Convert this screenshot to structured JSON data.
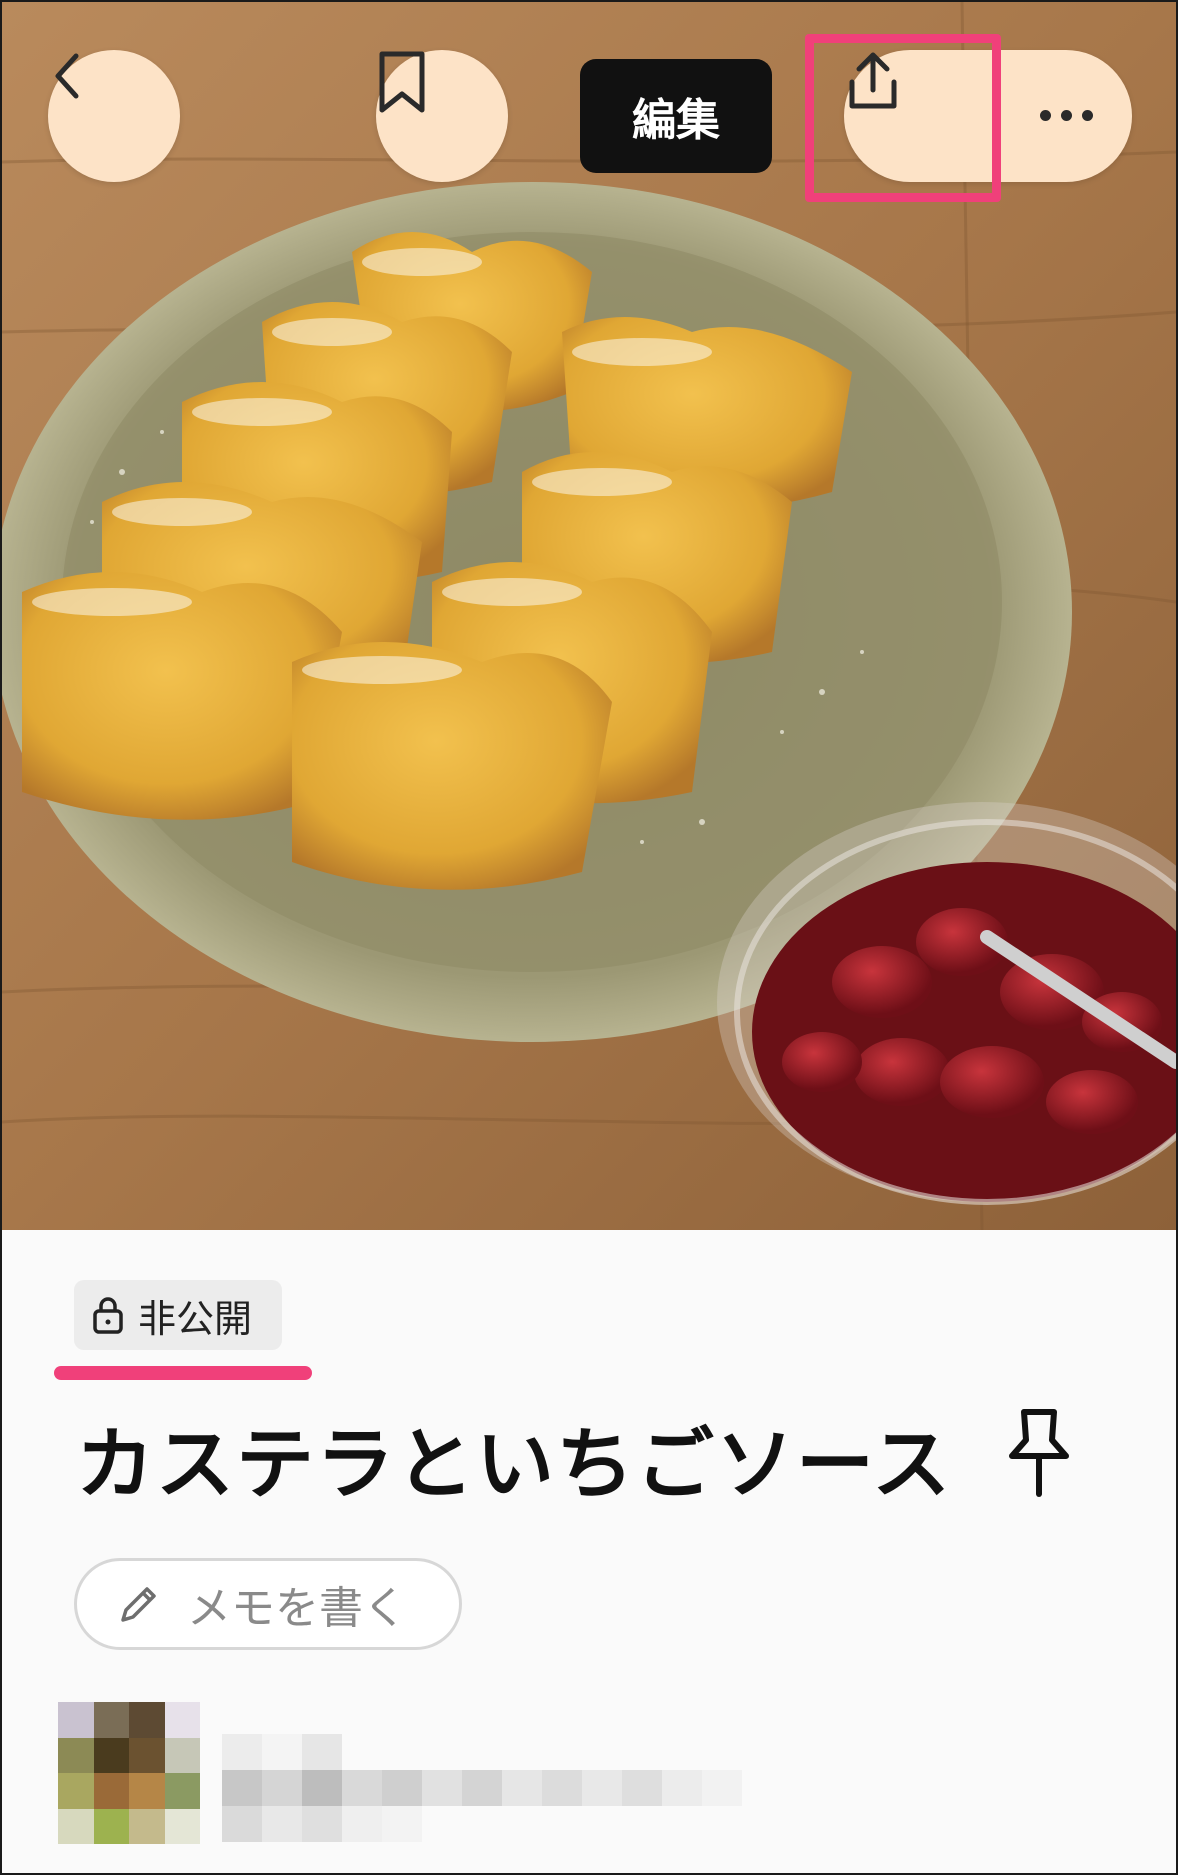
{
  "topbar": {
    "back_icon": "chevron-left-icon",
    "bookmark_icon": "bookmark-icon",
    "edit_label": "編集",
    "share_icon": "share-icon",
    "more_icon": "more-horizontal-icon",
    "highlight_color": "#f0407a",
    "button_color": "#fde3c7"
  },
  "recipe": {
    "visibility_label": "非公開",
    "visibility_icon": "lock-icon",
    "title": "カステラといちごソース",
    "pin_icon": "pin-icon",
    "memo_label": "メモを書く",
    "memo_icon": "pencil-icon"
  },
  "author": {
    "avatar_icon": "avatar"
  }
}
